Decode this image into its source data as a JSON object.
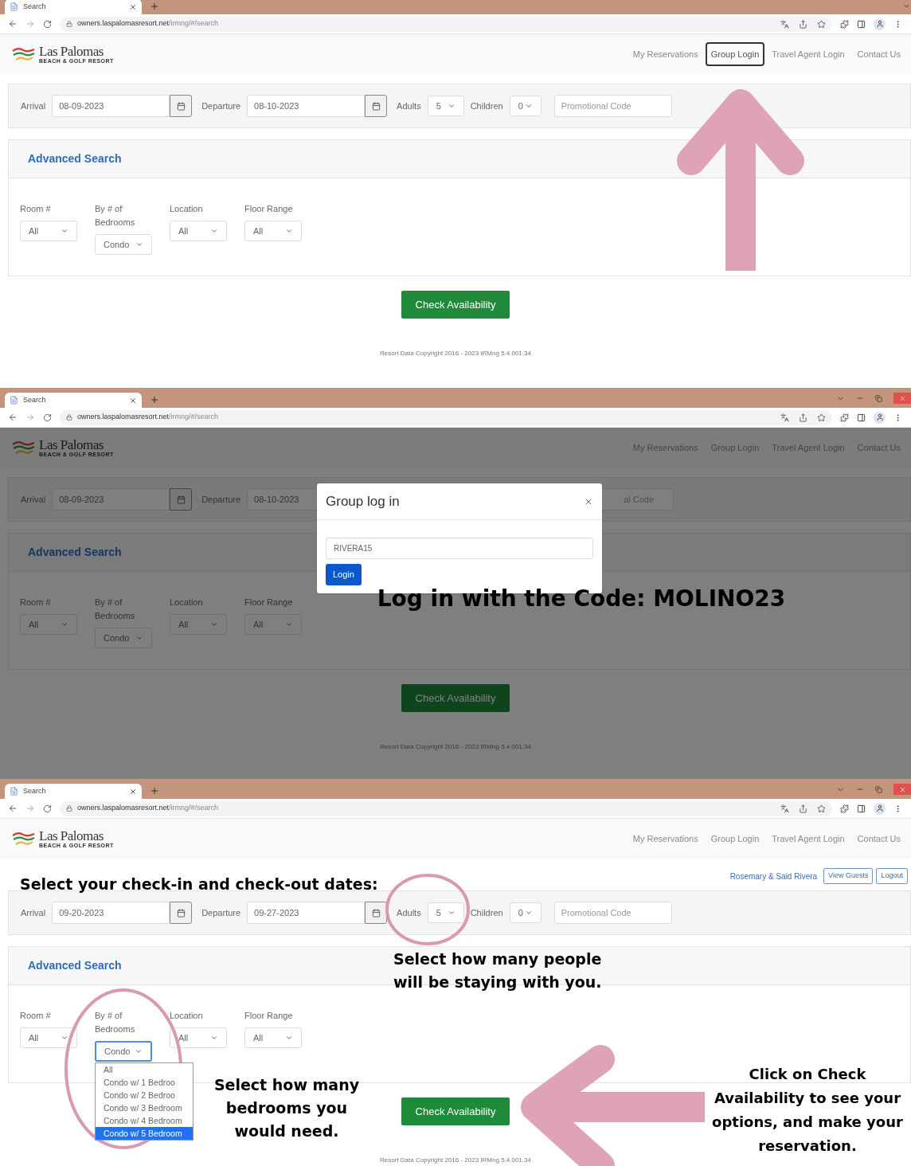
{
  "panels": [
    {
      "browser": {
        "tab_title": "Search",
        "url_host": "owners.laspalomasresort.net",
        "url_path": "/irmng/#/search"
      },
      "site": {
        "logo_name": "Las Palomas",
        "logo_tagline": "BEACH & GOLF RESORT",
        "nav": [
          {
            "label": "My Reservations",
            "selected": false
          },
          {
            "label": "Group Login",
            "selected": true
          },
          {
            "label": "Travel Agent Login",
            "selected": false
          },
          {
            "label": "Contact Us",
            "selected": false
          }
        ]
      },
      "search": {
        "arrival_label": "Arrival",
        "arrival": "08-09-2023",
        "departure_label": "Departure",
        "departure": "08-10-2023",
        "adults_label": "Adults",
        "adults": "5",
        "children_label": "Children",
        "children": "0",
        "promo_placeholder": "Promotional Code"
      },
      "advanced": {
        "title": "Advanced Search",
        "filters": [
          {
            "label": "Room #",
            "value": "All"
          },
          {
            "label": "By # of Bedrooms",
            "value": "Condo"
          },
          {
            "label": "Location",
            "value": "All"
          },
          {
            "label": "Floor Range",
            "value": "All"
          }
        ]
      },
      "check_button": "Check Availability",
      "copyright": "Resort Data Copyright 2016 - 2023 IRMng 5.4.001.34",
      "dimmed": false,
      "annotations": [
        {
          "kind": "arrow_up"
        }
      ]
    },
    {
      "browser": {
        "tab_title": "Search",
        "url_host": "owners.laspalomasresort.net",
        "url_path": "/irmng/#/search"
      },
      "site": {
        "logo_name": "Las Palomas",
        "logo_tagline": "BEACH & GOLF RESORT",
        "nav": [
          {
            "label": "My Reservations",
            "selected": false
          },
          {
            "label": "Group Login",
            "selected": false
          },
          {
            "label": "Travel Agent Login",
            "selected": false
          },
          {
            "label": "Contact Us",
            "selected": false
          }
        ]
      },
      "search": {
        "arrival_label": "Arrival",
        "arrival": "08-09-2023",
        "departure_label": "Departure",
        "departure": "08-10-2023",
        "promo_placeholder": "al Code"
      },
      "advanced": {
        "title": "Advanced Search",
        "filters": [
          {
            "label": "Room #",
            "value": "All"
          },
          {
            "label": "By # of Bedrooms",
            "value": "Condo"
          },
          {
            "label": "Location",
            "value": "All"
          },
          {
            "label": "Floor Range",
            "value": "All"
          }
        ]
      },
      "check_button": "Check Availability",
      "copyright": "Resort Data Copyright 2016 - 2023 IRMng 5.4.001.34",
      "dimmed": true,
      "modal": {
        "title": "Group log in",
        "code": "RIVERA15",
        "button": "Login"
      },
      "annotations": [
        {
          "kind": "caption",
          "text": "Log in with the Code: MOLINO23"
        }
      ]
    },
    {
      "browser": {
        "tab_title": "Search",
        "url_host": "owners.laspalomasresort.net",
        "url_path": "/irmng/#/search"
      },
      "site": {
        "logo_name": "Las Palomas",
        "logo_tagline": "BEACH & GOLF RESORT",
        "nav": [
          {
            "label": "My Reservations",
            "selected": false
          },
          {
            "label": "Group Login",
            "selected": false
          },
          {
            "label": "Travel Agent Login",
            "selected": false
          },
          {
            "label": "Contact Us",
            "selected": false
          }
        ]
      },
      "user": {
        "name": "Rosemary & Said Rivera",
        "buttons": [
          "View Guests",
          "Logout"
        ]
      },
      "search": {
        "arrival_label": "Arrival",
        "arrival": "09-20-2023",
        "departure_label": "Departure",
        "departure": "09-27-2023",
        "adults_label": "Adults",
        "adults": "5",
        "children_label": "Children",
        "children": "0",
        "promo_placeholder": "Promotional Code"
      },
      "advanced": {
        "title": "Advanced Search",
        "filters": [
          {
            "label": "Room #",
            "value": "All"
          },
          {
            "label": "By # of Bedrooms",
            "value": "Condo",
            "options": [
              {
                "label": "All",
                "selected": false
              },
              {
                "label": "Condo w/ 1 Bedroo",
                "selected": false
              },
              {
                "label": "Condo w/ 2 Bedroo",
                "selected": false
              },
              {
                "label": "Condo w/ 3 Bedroom",
                "selected": false
              },
              {
                "label": "Condo w/ 4 Bedroom",
                "selected": false
              },
              {
                "label": "Condo w/ 5 Bedroom",
                "selected": true
              }
            ]
          },
          {
            "label": "Location",
            "value": "All"
          },
          {
            "label": "Floor Range",
            "value": "All"
          }
        ]
      },
      "check_button": "Check Availability",
      "copyright": "Resort Data Copyright 2016 - 2023 IRMng 5.4.001.34",
      "dimmed": false,
      "annotations": [
        {
          "kind": "caption",
          "text": "Select your check-in and check-out dates:"
        },
        {
          "kind": "ellipse"
        },
        {
          "kind": "caption",
          "text": "Select how many people will be staying with you."
        },
        {
          "kind": "ellipse"
        },
        {
          "kind": "caption",
          "text": "Select how many bedrooms you would need."
        },
        {
          "kind": "arrow_left"
        },
        {
          "kind": "caption",
          "text": "Click on Check Availability to see your options, and make your reservation."
        }
      ]
    }
  ]
}
